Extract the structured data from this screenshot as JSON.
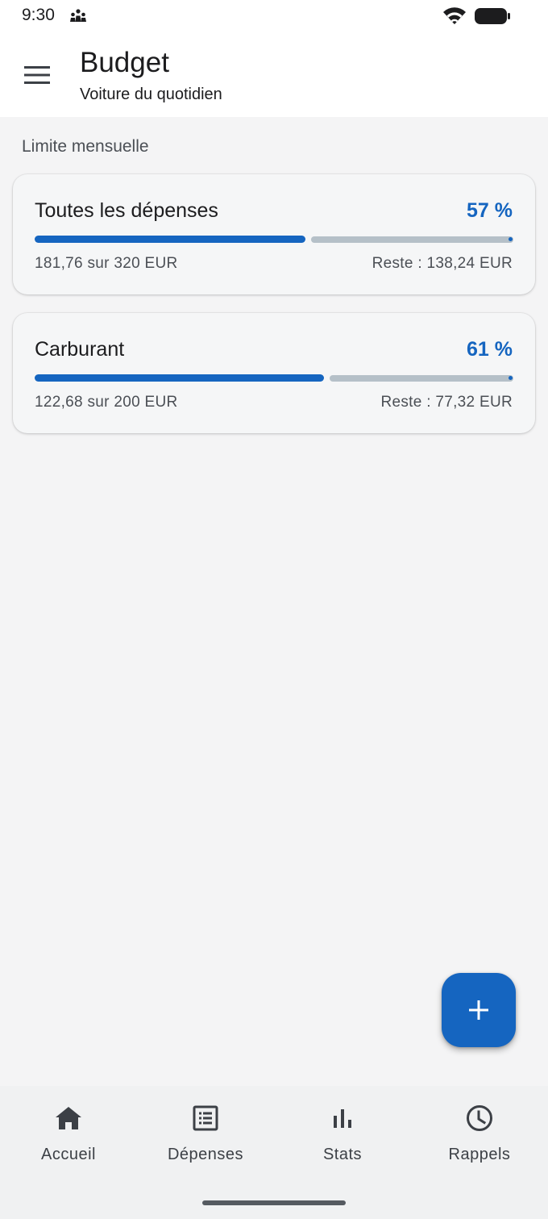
{
  "status_bar": {
    "time": "9:30",
    "notification_icon": "people-group-icon",
    "wifi_icon": "wifi-icon",
    "battery_icon": "battery-full-icon"
  },
  "app_bar": {
    "menu_icon": "menu-icon",
    "title": "Budget",
    "subtitle": "Voiture du quotidien"
  },
  "section": {
    "label": "Limite mensuelle"
  },
  "budgets": [
    {
      "title": "Toutes les dépenses",
      "percent_label": "57 %",
      "progress": 0.57,
      "amount_label": "181,76 sur 320 EUR",
      "rest_label": "Reste : 138,24 EUR"
    },
    {
      "title": "Carburant",
      "percent_label": "61 %",
      "progress": 0.61,
      "amount_label": "122,68 sur 200 EUR",
      "rest_label": "Reste : 77,32 EUR"
    }
  ],
  "fab": {
    "icon": "plus-icon"
  },
  "bottom_nav": {
    "items": [
      {
        "label": "Accueil",
        "icon": "home-icon"
      },
      {
        "label": "Dépenses",
        "icon": "list-icon"
      },
      {
        "label": "Stats",
        "icon": "bar-chart-icon"
      },
      {
        "label": "Rappels",
        "icon": "clock-icon"
      }
    ]
  },
  "colors": {
    "accent": "#1565c0",
    "track": "#b5c0c8",
    "background": "#f4f4f5"
  }
}
